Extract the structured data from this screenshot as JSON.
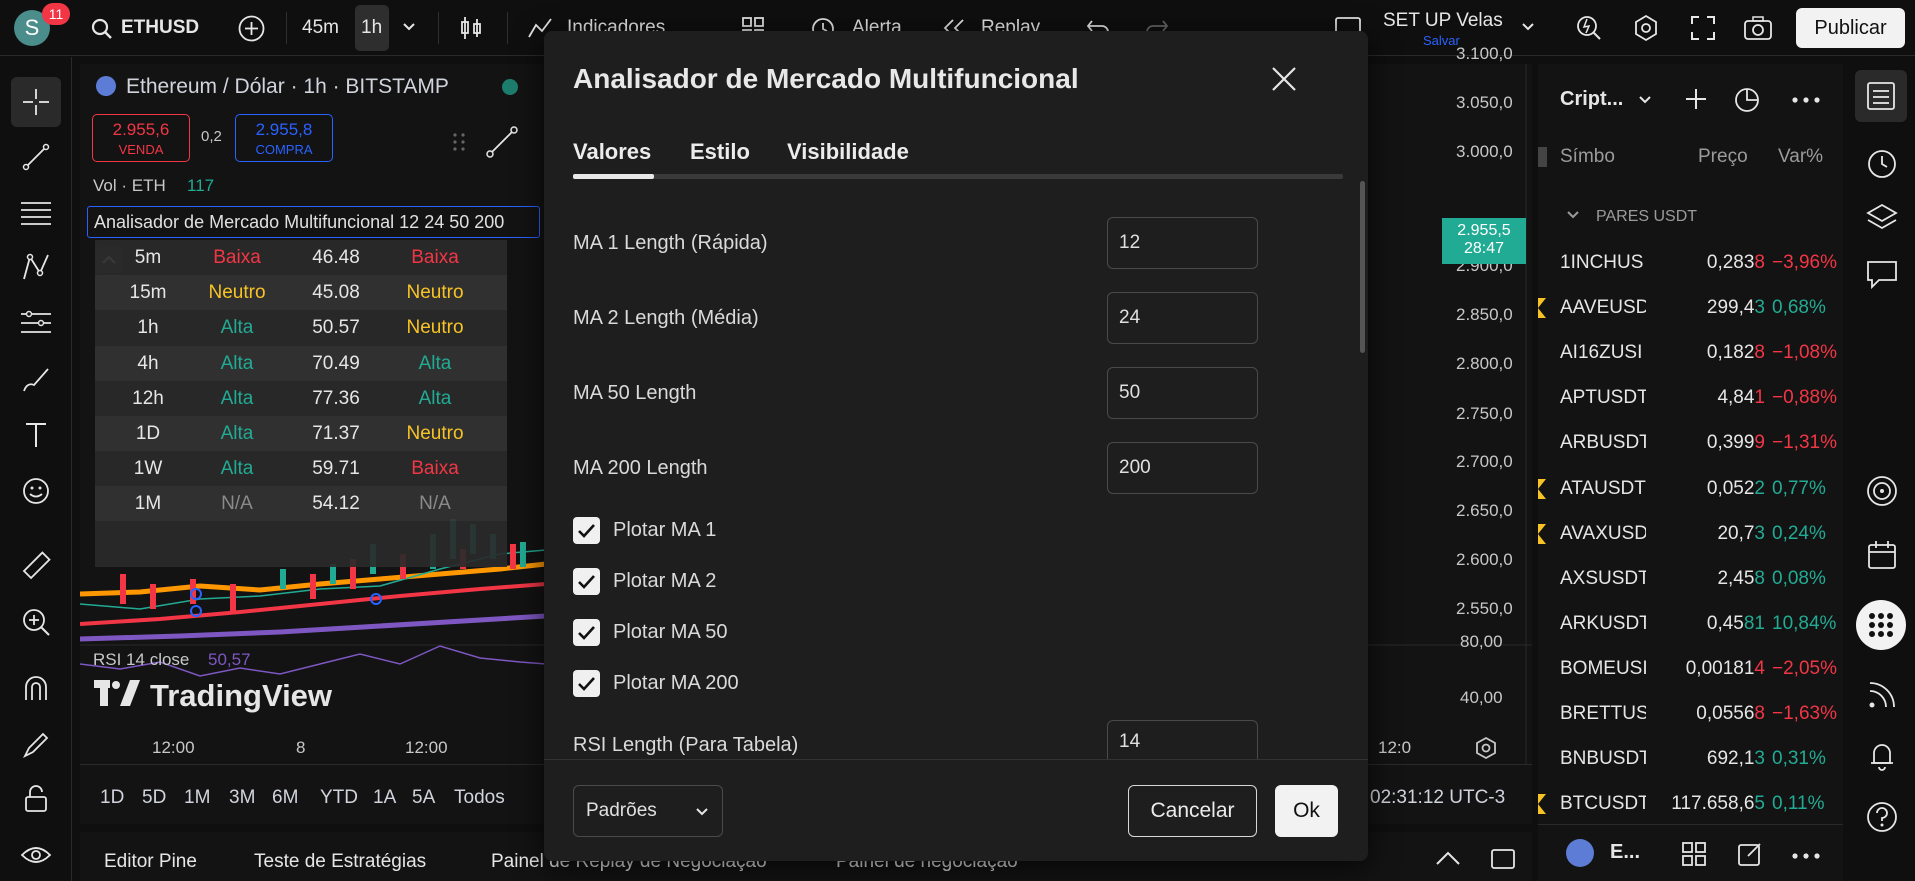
{
  "topbar": {
    "avatar_letter": "S",
    "notif_count": "11",
    "symbol": "ETHUSD",
    "interval_1": "45m",
    "interval_2": "1h",
    "indicators": "Indicadores",
    "alert": "Alerta",
    "replay": "Replay",
    "layout_name": "SET UP Velas",
    "layout_save": "Salvar",
    "publish": "Publicar"
  },
  "chart": {
    "title": "Ethereum / Dólar · 1h · BITSTAMP",
    "sell_price": "2.955,6",
    "sell_label": "VENDA",
    "spread": "0,2",
    "buy_price": "2.955,8",
    "buy_label": "COMPRA",
    "vol_label": "Vol · ETH",
    "vol_value": "117",
    "indicator_tooltip": "Analisador de Mercado Multifuncional 12 24 50 200",
    "table_rows": [
      {
        "tf": "5m",
        "trend": "Baixa",
        "rsi": "46.48",
        "trend2": "Baixa"
      },
      {
        "tf": "15m",
        "trend": "Neutro",
        "rsi": "45.08",
        "trend2": "Neutro"
      },
      {
        "tf": "1h",
        "trend": "Alta",
        "rsi": "50.57",
        "trend2": "Neutro"
      },
      {
        "tf": "4h",
        "trend": "Alta",
        "rsi": "70.49",
        "trend2": "Alta"
      },
      {
        "tf": "12h",
        "trend": "Alta",
        "rsi": "77.36",
        "trend2": "Alta"
      },
      {
        "tf": "1D",
        "trend": "Alta",
        "rsi": "71.37",
        "trend2": "Neutro"
      },
      {
        "tf": "1W",
        "trend": "Alta",
        "rsi": "59.71",
        "trend2": "Baixa"
      },
      {
        "tf": "1M",
        "trend": "N/A",
        "rsi": "54.12",
        "trend2": "N/A"
      }
    ],
    "price_axis": [
      "3.100,0",
      "3.050,0",
      "3.000,0",
      "2.900,0",
      "2.850,0",
      "2.800,0",
      "2.750,0",
      "2.700,0",
      "2.650,0",
      "2.600,0",
      "2.550,0"
    ],
    "last_price": "2.955,5",
    "countdown": "28:47",
    "rsi_label": "RSI 14 close",
    "rsi_value": "50,57",
    "rsi_axis": [
      "80,00",
      "40,00"
    ],
    "watermark": "TradingView",
    "time_axis": [
      "12:00",
      "8",
      "12:00",
      "12:0"
    ],
    "ranges": [
      "1D",
      "5D",
      "1M",
      "3M",
      "6M",
      "YTD",
      "1A",
      "5A",
      "Todos"
    ],
    "clock": "02:31:12 UTC-3"
  },
  "bottom_tabs": [
    "Editor Pine",
    "Teste de Estratégias",
    "Painel de Replay de Negociação",
    "Painel de negociação"
  ],
  "watchlist": {
    "title": "Cript...",
    "col_symbol": "Símbo",
    "col_price": "Preço",
    "col_change": "Var%",
    "group": "PARES USDT",
    "rows": [
      {
        "sym": "1INCHUS",
        "price_main": "0,283",
        "price_tail": "8",
        "chg": "−3,96%",
        "dir": "down",
        "flag": false
      },
      {
        "sym": "AAVEUSD",
        "price_main": "299,4",
        "price_tail": "3",
        "chg": "0,68%",
        "dir": "up",
        "flag": true
      },
      {
        "sym": "AI16ZUSI",
        "price_main": "0,182",
        "price_tail": "8",
        "chg": "−1,08%",
        "dir": "down",
        "flag": false
      },
      {
        "sym": "APTUSDT",
        "price_main": "4,84",
        "price_tail": "1",
        "chg": "−0,88%",
        "dir": "down",
        "flag": false
      },
      {
        "sym": "ARBUSDT",
        "price_main": "0,399",
        "price_tail": "9",
        "chg": "−1,31%",
        "dir": "down",
        "flag": false
      },
      {
        "sym": "ATAUSDT",
        "price_main": "0,052",
        "price_tail": "2",
        "chg": "0,77%",
        "dir": "up",
        "flag": true
      },
      {
        "sym": "AVAXUSD",
        "price_main": "20,7",
        "price_tail": "3",
        "chg": "0,24%",
        "dir": "up",
        "flag": true
      },
      {
        "sym": "AXSUSDT",
        "price_main": "2,45",
        "price_tail": "8",
        "chg": "0,08%",
        "dir": "up",
        "flag": false
      },
      {
        "sym": "ARKUSDT",
        "price_main": "0,45",
        "price_tail": "81",
        "chg": "10,84%",
        "dir": "up",
        "flag": false
      },
      {
        "sym": "BOMEUSI",
        "price_main": "0,00181",
        "price_tail": "4",
        "chg": "−2,05%",
        "dir": "down",
        "flag": false
      },
      {
        "sym": "BRETTUS",
        "price_main": "0,0556",
        "price_tail": "8",
        "chg": "−1,63%",
        "dir": "down",
        "flag": false
      },
      {
        "sym": "BNBUSDT",
        "price_main": "692,1",
        "price_tail": "3",
        "chg": "0,31%",
        "dir": "up",
        "flag": false
      },
      {
        "sym": "BTCUSDT",
        "price_main": "117.658,6",
        "price_tail": "5",
        "chg": "0,11%",
        "dir": "up",
        "flag": true
      }
    ],
    "footer_sym": "E..."
  },
  "modal": {
    "title": "Analisador de Mercado Multifuncional",
    "tabs": [
      "Valores",
      "Estilo",
      "Visibilidade"
    ],
    "inputs": [
      {
        "label": "MA 1 Length (Rápida)",
        "value": "12"
      },
      {
        "label": "MA 2 Length (Média)",
        "value": "24"
      },
      {
        "label": "MA 50 Length",
        "value": "50"
      },
      {
        "label": "MA 200 Length",
        "value": "200"
      }
    ],
    "checkboxes": [
      {
        "label": "Plotar MA 1",
        "checked": true
      },
      {
        "label": "Plotar MA 2",
        "checked": true
      },
      {
        "label": "Plotar MA 50",
        "checked": true
      },
      {
        "label": "Plotar MA 200",
        "checked": true
      }
    ],
    "rsi_input": {
      "label": "RSI Length (Para Tabela)",
      "value": "14"
    },
    "defaults": "Padrões",
    "cancel": "Cancelar",
    "ok": "Ok"
  },
  "colors": {
    "up": "#22ab94",
    "down": "#f23645",
    "neutral": "#f7c325",
    "accent_blue": "#2962ff",
    "avatar": "#4a8d8a"
  }
}
